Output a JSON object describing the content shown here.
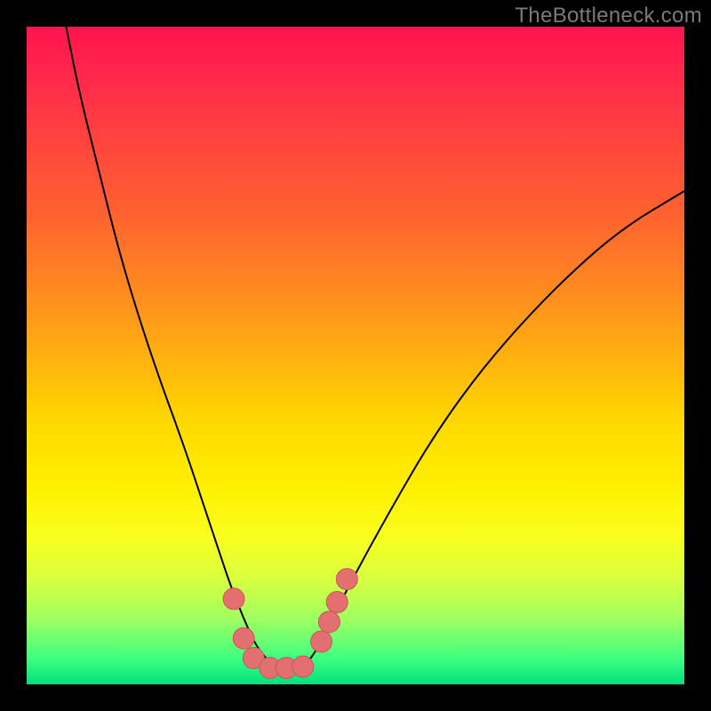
{
  "watermark": "TheBottleneck.com",
  "colors": {
    "dot": "#e27070",
    "dot_stroke": "#c95858",
    "curve": "#000000"
  },
  "chart_data": {
    "type": "line",
    "title": "",
    "xlabel": "",
    "ylabel": "",
    "xlim": [
      0,
      100
    ],
    "ylim": [
      0,
      100
    ],
    "note": "Bottleneck-style V curve. Axes have no tick labels in the original image; values below are pixel-derived estimates on a 0–100 plot-percentage scale. y≈0 is the green floor (best), y≈100 is the red top (worst).",
    "series": [
      {
        "name": "bottleneck-curve",
        "x": [
          6,
          8,
          11,
          14,
          17,
          20,
          24,
          27,
          29,
          31,
          33,
          35,
          37.8,
          42,
          44,
          46,
          49,
          55,
          62,
          70,
          80,
          90,
          100
        ],
        "y": [
          100,
          90,
          78,
          66,
          56,
          47,
          36,
          27,
          21,
          15,
          10,
          5.5,
          2.5,
          2.5,
          5,
          9,
          15,
          26,
          38,
          49,
          60,
          69,
          75
        ]
      }
    ],
    "markers": {
      "name": "highlight-dots",
      "note": "Salmon circles clustered near the valley bottom",
      "points": [
        {
          "x": 31.5,
          "y": 13
        },
        {
          "x": 33.0,
          "y": 7
        },
        {
          "x": 34.5,
          "y": 4
        },
        {
          "x": 37.0,
          "y": 2.5
        },
        {
          "x": 39.5,
          "y": 2.5
        },
        {
          "x": 42.0,
          "y": 2.7
        },
        {
          "x": 44.8,
          "y": 6.5
        },
        {
          "x": 46.0,
          "y": 9.5
        },
        {
          "x": 47.2,
          "y": 12.5
        },
        {
          "x": 48.7,
          "y": 16
        }
      ]
    }
  }
}
